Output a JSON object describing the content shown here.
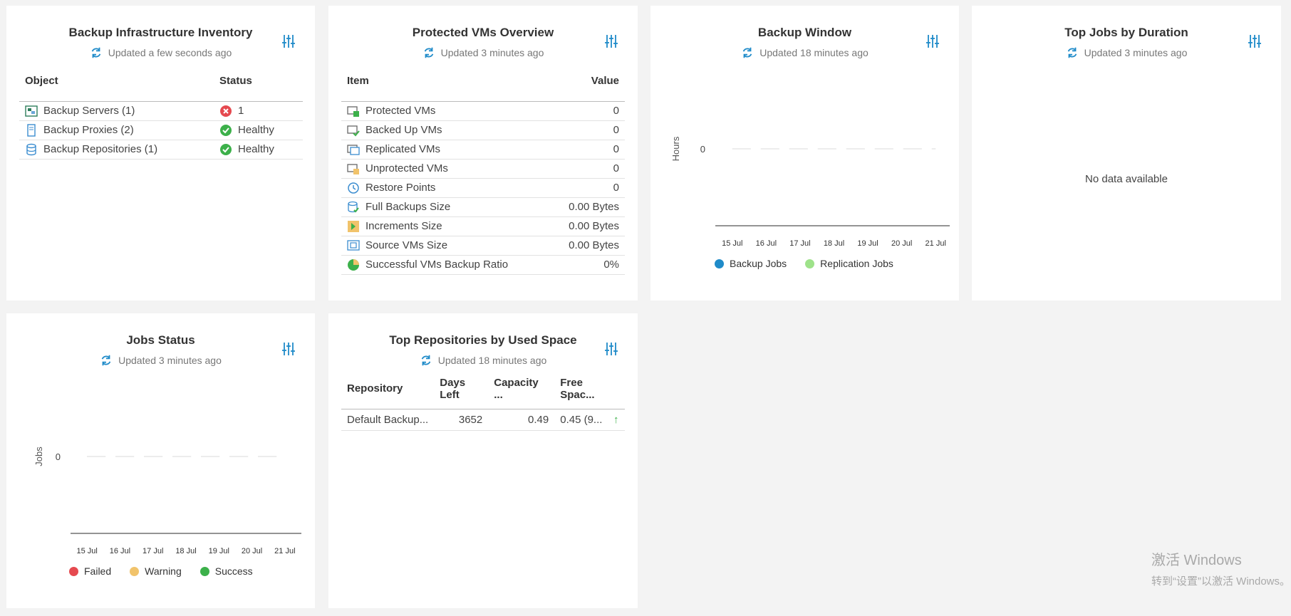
{
  "cards": {
    "inventory": {
      "title": "Backup Infrastructure Inventory",
      "updated": "Updated a few seconds ago",
      "columns": [
        "Object",
        "Status"
      ],
      "rows": [
        {
          "object": "Backup Servers (1)",
          "status": "1",
          "icon": "backup-server-icon",
          "status_icon": "error-icon"
        },
        {
          "object": "Backup Proxies (2)",
          "status": "Healthy",
          "icon": "backup-proxy-icon",
          "status_icon": "success-icon"
        },
        {
          "object": "Backup Repositories (1)",
          "status": "Healthy",
          "icon": "repository-icon",
          "status_icon": "success-icon"
        }
      ]
    },
    "protected": {
      "title": "Protected VMs Overview",
      "updated": "Updated 3 minutes ago",
      "columns": [
        "Item",
        "Value"
      ],
      "rows": [
        {
          "item": "Protected VMs",
          "value": "0",
          "icon": "protected-vm-icon"
        },
        {
          "item": "Backed Up VMs",
          "value": "0",
          "icon": "backed-up-vm-icon"
        },
        {
          "item": "Replicated VMs",
          "value": "0",
          "icon": "replicated-vm-icon"
        },
        {
          "item": "Unprotected VMs",
          "value": "0",
          "icon": "unprotected-vm-icon"
        },
        {
          "item": "Restore Points",
          "value": "0",
          "icon": "restore-point-icon"
        },
        {
          "item": "Full Backups Size",
          "value": "0.00 Bytes",
          "icon": "full-backup-icon"
        },
        {
          "item": "Increments Size",
          "value": "0.00 Bytes",
          "icon": "increment-icon"
        },
        {
          "item": "Source VMs Size",
          "value": "0.00 Bytes",
          "icon": "source-vm-icon"
        },
        {
          "item": "Successful VMs Backup Ratio",
          "value": "0%",
          "icon": "pie-ratio-icon"
        }
      ]
    },
    "backup_window": {
      "title": "Backup Window",
      "updated": "Updated 18 minutes ago",
      "ylabel": "Hours",
      "ytick": "0",
      "xticks": [
        "15 Jul",
        "16 Jul",
        "17 Jul",
        "18 Jul",
        "19 Jul",
        "20 Jul",
        "21 Jul"
      ],
      "legend": [
        {
          "name": "Backup Jobs",
          "color": "#1f8bc9"
        },
        {
          "name": "Replication Jobs",
          "color": "#9ee28a"
        }
      ]
    },
    "top_jobs": {
      "title": "Top Jobs by Duration",
      "updated": "Updated 3 minutes ago",
      "empty": "No data available"
    },
    "jobs_status": {
      "title": "Jobs Status",
      "updated": "Updated 3 minutes ago",
      "ylabel": "Jobs",
      "ytick": "0",
      "xticks": [
        "15 Jul",
        "16 Jul",
        "17 Jul",
        "18 Jul",
        "19 Jul",
        "20 Jul",
        "21 Jul"
      ],
      "legend": [
        {
          "name": "Failed",
          "color": "#e5494f"
        },
        {
          "name": "Warning",
          "color": "#f1c36b"
        },
        {
          "name": "Success",
          "color": "#3cb04a"
        }
      ]
    },
    "repositories": {
      "title": "Top Repositories by Used Space",
      "updated": "Updated 18 minutes ago",
      "columns": [
        "Repository",
        "Days Left",
        "Capacity ...",
        "Free Spac..."
      ],
      "rows": [
        {
          "repository": "Default Backup...",
          "days_left": "3652",
          "capacity": "0.49",
          "free": "0.45 (9...",
          "trend": "↑"
        }
      ]
    }
  },
  "chart_data": [
    {
      "type": "line",
      "title": "Backup Window",
      "ylabel": "Hours",
      "x": [
        "15 Jul",
        "16 Jul",
        "17 Jul",
        "18 Jul",
        "19 Jul",
        "20 Jul",
        "21 Jul"
      ],
      "series": [
        {
          "name": "Backup Jobs",
          "values": [
            0,
            0,
            0,
            0,
            0,
            0,
            0
          ]
        },
        {
          "name": "Replication Jobs",
          "values": [
            0,
            0,
            0,
            0,
            0,
            0,
            0
          ]
        }
      ],
      "yticks": [
        0
      ]
    },
    {
      "type": "line",
      "title": "Jobs Status",
      "ylabel": "Jobs",
      "x": [
        "15 Jul",
        "16 Jul",
        "17 Jul",
        "18 Jul",
        "19 Jul",
        "20 Jul",
        "21 Jul"
      ],
      "series": [
        {
          "name": "Failed",
          "values": [
            0,
            0,
            0,
            0,
            0,
            0,
            0
          ]
        },
        {
          "name": "Warning",
          "values": [
            0,
            0,
            0,
            0,
            0,
            0,
            0
          ]
        },
        {
          "name": "Success",
          "values": [
            0,
            0,
            0,
            0,
            0,
            0,
            0
          ]
        }
      ],
      "yticks": [
        0
      ]
    }
  ],
  "watermark": {
    "title": "激活 Windows",
    "subtitle": "转到“设置”以激活 Windows。"
  },
  "colors": {
    "accent": "#1f8bc9",
    "error": "#e5494f",
    "success": "#3cb04a",
    "background": "#f3f3f3"
  }
}
